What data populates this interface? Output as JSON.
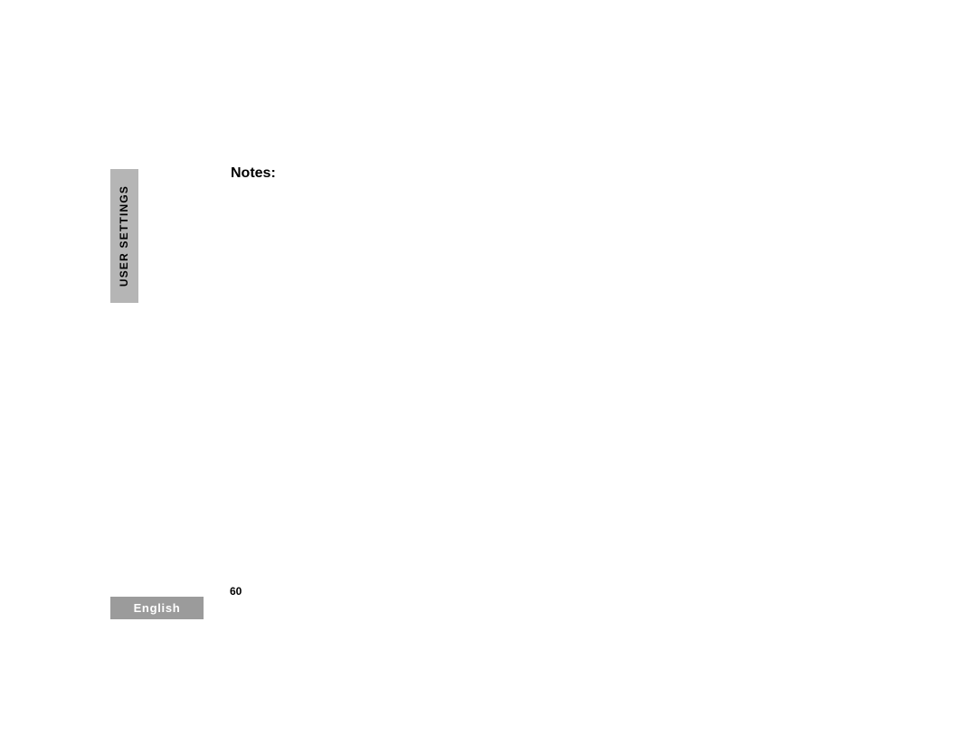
{
  "sidebar": {
    "section_label": "USER SETTINGS"
  },
  "main": {
    "heading": "Notes:"
  },
  "footer": {
    "page_number": "60",
    "language": "English"
  }
}
